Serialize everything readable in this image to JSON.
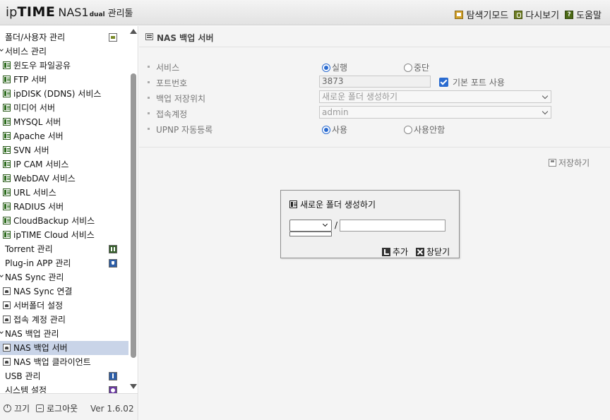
{
  "header": {
    "logo": {
      "ip": "ip",
      "time": "TIME",
      "nas": "NAS1",
      "dual": "dual",
      "kor": "관리툴"
    },
    "links": [
      {
        "label": "탐색기모드",
        "icon": "explorer-icon"
      },
      {
        "label": "다시보기",
        "icon": "reload-icon"
      },
      {
        "label": "도움말",
        "icon": "help-icon"
      }
    ]
  },
  "sidebar": {
    "items": [
      {
        "label": "폴더/사용자 관리",
        "type": "l1",
        "right_icon": "folder-icon"
      },
      {
        "label": "서비스 관리",
        "type": "cat"
      },
      {
        "label": "윈도우 파일공유",
        "type": "l2"
      },
      {
        "label": "FTP 서버",
        "type": "l2"
      },
      {
        "label": "ipDISK (DDNS) 서비스",
        "type": "l2"
      },
      {
        "label": "미디어 서버",
        "type": "l2"
      },
      {
        "label": "MYSQL 서버",
        "type": "l2"
      },
      {
        "label": "Apache 서버",
        "type": "l2"
      },
      {
        "label": "SVN 서버",
        "type": "l2"
      },
      {
        "label": "IP CAM 서비스",
        "type": "l2"
      },
      {
        "label": "WebDAV 서비스",
        "type": "l2"
      },
      {
        "label": "URL 서비스",
        "type": "l2"
      },
      {
        "label": "RADIUS 서버",
        "type": "l2"
      },
      {
        "label": "CloudBackup 서비스",
        "type": "l2"
      },
      {
        "label": "ipTIME Cloud 서비스",
        "type": "l2"
      },
      {
        "label": "Torrent 관리",
        "type": "l1",
        "right_icon": "torrent-icon"
      },
      {
        "label": "Plug-in APP 관리",
        "type": "l1",
        "right_icon": "plugin-icon"
      },
      {
        "label": "NAS Sync 관리",
        "type": "cat"
      },
      {
        "label": "NAS Sync 연결",
        "type": "l2d"
      },
      {
        "label": "서버폴더 설정",
        "type": "l2d"
      },
      {
        "label": "접속 계정 관리",
        "type": "l2d"
      },
      {
        "label": "NAS 백업 관리",
        "type": "cat"
      },
      {
        "label": "NAS 백업 서버",
        "type": "l2d",
        "selected": true
      },
      {
        "label": "NAS 백업 클라이언트",
        "type": "l2d"
      },
      {
        "label": "USB 관리",
        "type": "l1",
        "right_icon": "usb-icon"
      },
      {
        "label": "시스템 설정",
        "type": "l1",
        "right_icon": "system-icon"
      }
    ],
    "footer": {
      "power_label": "끄기",
      "logout_label": "로그아웃",
      "version": "Ver 1.6.02"
    }
  },
  "main": {
    "title": "NAS 백업 서버",
    "form": {
      "service": {
        "label": "서비스",
        "opt_on": "실행",
        "opt_off": "중단",
        "selected": "실행"
      },
      "port": {
        "label": "포트번호",
        "value": "3873",
        "default_port_label": "기본 포트 사용",
        "default_port_checked": true
      },
      "location": {
        "label": "백업 저장위치",
        "value": "새로운 폴더 생성하기"
      },
      "account": {
        "label": "접속계정",
        "value": "admin"
      },
      "upnp": {
        "label": "UPNP 자동등록",
        "opt_on": "사용",
        "opt_off": "사용안함",
        "selected": "사용"
      }
    },
    "save_label": "저장하기"
  },
  "dialog": {
    "title": "새로운 폴더 생성하기",
    "slash": "/",
    "folder_value": "",
    "add_label": "추가",
    "close_label": "창닫기"
  }
}
